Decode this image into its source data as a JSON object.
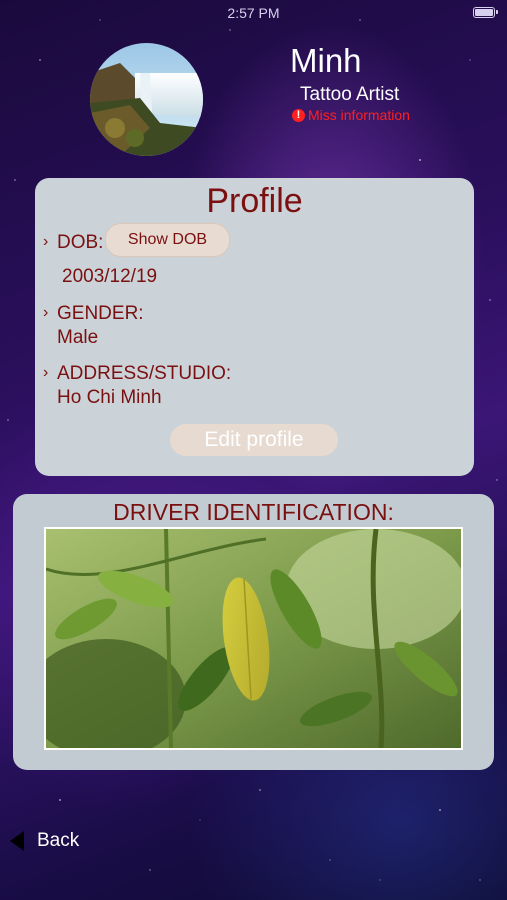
{
  "status_bar": {
    "time": "2:57 PM"
  },
  "user": {
    "name": "Minh",
    "role": "Tattoo Artist",
    "warning": "Miss information"
  },
  "profile": {
    "title": "Profile",
    "dob_label": "DOB:",
    "show_dob_button": "Show DOB",
    "dob_value": "2003/12/19",
    "gender_label": "GENDER:",
    "gender_value": "Male",
    "address_label": "ADDRESS/STUDIO:",
    "address_value": "Ho Chi Minh",
    "edit_button": "Edit profile",
    "chevron": "›"
  },
  "driver_id": {
    "title": "DRIVER IDENTIFICATION:"
  },
  "nav": {
    "back_label": "Back"
  },
  "icons": {
    "alert": "!"
  },
  "colors": {
    "accent_text": "#7a1010",
    "warning": "#ff2020",
    "card_bg": "#cbd2d8"
  }
}
